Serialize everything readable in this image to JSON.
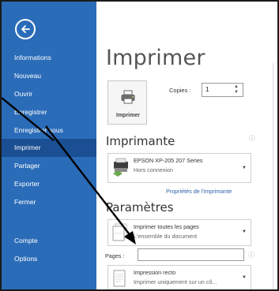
{
  "sidebar": {
    "items": [
      {
        "label": "Informations"
      },
      {
        "label": "Nouveau"
      },
      {
        "label": "Ouvrir"
      },
      {
        "label": "Enregistrer"
      },
      {
        "label": "Enregistrer sous"
      },
      {
        "label": "Imprimer",
        "active": true
      },
      {
        "label": "Partager"
      },
      {
        "label": "Exporter"
      },
      {
        "label": "Fermer"
      },
      {
        "label": "Compte"
      },
      {
        "label": "Options"
      }
    ]
  },
  "main": {
    "title": "Imprimer",
    "print_button_label": "Imprimer",
    "copies_label": "Copies :",
    "copies_value": "1",
    "printer_section_title": "Imprimante",
    "printer": {
      "name": "EPSON XP-205 207 Series",
      "status": "Hors connexion"
    },
    "printer_properties_link": "Propriétés de l'imprimante",
    "settings_section_title": "Paramètres",
    "pages_setting": {
      "line1": "Imprimer toutes les pages",
      "line2": "L'ensemble du document"
    },
    "pages_label": "Pages :",
    "pages_value": "",
    "sides_setting": {
      "line1": "Impression recto",
      "line2": "Imprimer uniquement sur un cô..."
    }
  },
  "colors": {
    "sidebar_bg": "#2b6cb8",
    "sidebar_active": "#1a4f93",
    "link": "#2b5fa8",
    "annotation_arrow": "#000000"
  },
  "icons": {
    "back": "back-arrow-circle-icon",
    "printer": "printer-icon",
    "info": "info-icon",
    "pages": "pages-document-icon",
    "sides": "single-sided-page-icon"
  }
}
